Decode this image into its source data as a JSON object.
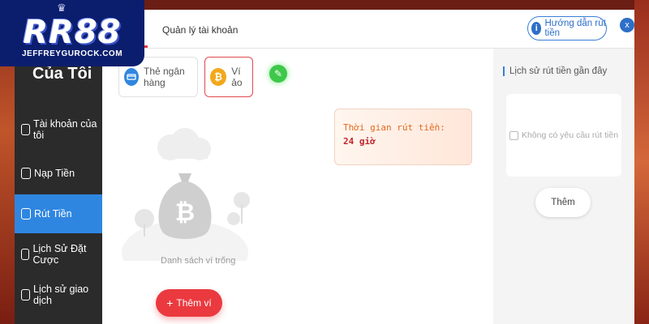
{
  "logo": {
    "brand": "RR88",
    "domain": "JEFFREYGUROCK.COM"
  },
  "sidebar": {
    "title": "Của Tôi",
    "items": [
      {
        "label": "Tài khoản của tôi",
        "icon": "user-icon"
      },
      {
        "label": "Nạp Tiền",
        "icon": "deposit-icon"
      },
      {
        "label": "Rút Tiền",
        "icon": "withdraw-icon",
        "active": true
      },
      {
        "label": "Lịch Sử Đặt Cược",
        "icon": "bet-history-icon"
      },
      {
        "label": "Lịch sử giao dịch",
        "icon": "transaction-icon"
      }
    ]
  },
  "header": {
    "tab_label": "Quản lý tài khoản",
    "guide_label": "Hướng dẫn rút tiền",
    "close_label": "x"
  },
  "methods": [
    {
      "label": "Thẻ ngân hàng",
      "icon": "bank-card-icon",
      "color": "#2f86e0"
    },
    {
      "label": "Ví ảo",
      "icon": "bitcoin-icon",
      "color": "#f2a81d",
      "selected": true
    }
  ],
  "wallet": {
    "empty_label": "Danh sách ví trống",
    "add_label": "Thêm ví"
  },
  "notice": {
    "label": "Thời gian rút tiền:",
    "value": "24 giờ"
  },
  "history": {
    "title": "Lịch sử rút tiền gần đây",
    "empty_label": "Không có yêu cầu rút tiền",
    "more_label": "Thêm"
  },
  "colors": {
    "accent_red": "#ea3a3f",
    "accent_blue": "#2f86e0",
    "sidebar_bg": "#2b2b2b",
    "logo_bg": "#0b1e6e"
  }
}
